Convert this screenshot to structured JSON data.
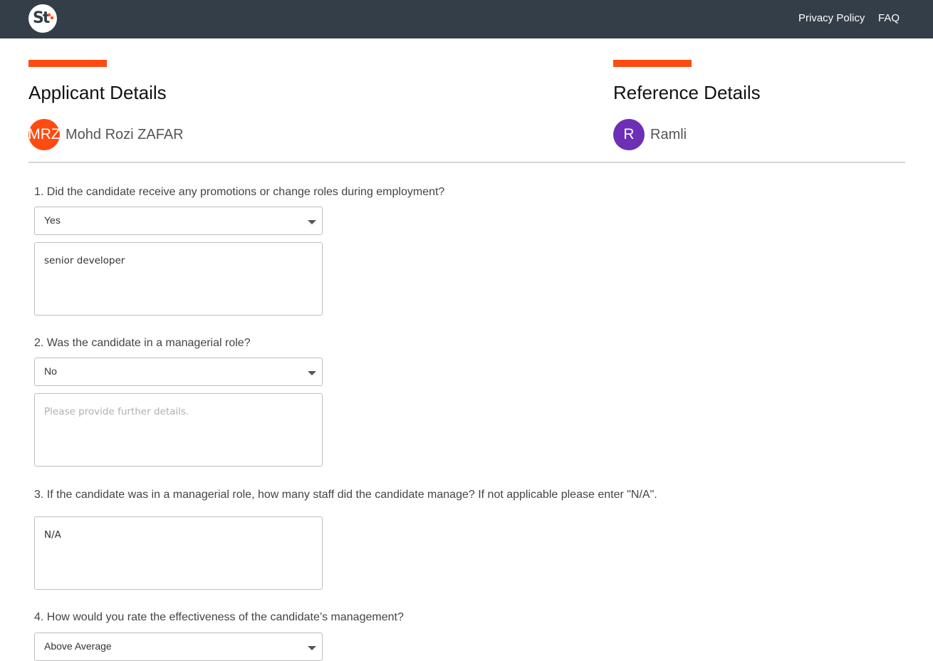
{
  "header": {
    "logo_text": "St",
    "nav": {
      "privacy": "Privacy Policy",
      "faq": "FAQ"
    }
  },
  "applicant": {
    "title": "Applicant Details",
    "initials": "MRZ",
    "name": "Mohd Rozi ZAFAR",
    "avatar_color": "#ff4b12"
  },
  "reference": {
    "title": "Reference Details",
    "initials": "R",
    "name": "Ramli",
    "avatar_color": "#6e2fb7"
  },
  "colors": {
    "accent": "#ff4b12",
    "topbar": "#333e48"
  },
  "questions": [
    {
      "label": "1. Did the candidate receive any promotions or change roles during employment?",
      "select_value": "Yes",
      "details_value": "senior developer"
    },
    {
      "label": "2. Was the candidate in a managerial role?",
      "select_value": "No",
      "details_placeholder": "Please provide further details."
    },
    {
      "label": "3. If the candidate was in a managerial role, how many staff did the candidate manage? If not applicable please enter \"N/A\".",
      "details_value": "N/A"
    },
    {
      "label": "4. How would you rate the effectiveness of the candidate’s management?",
      "select_value": "Above Average"
    }
  ]
}
